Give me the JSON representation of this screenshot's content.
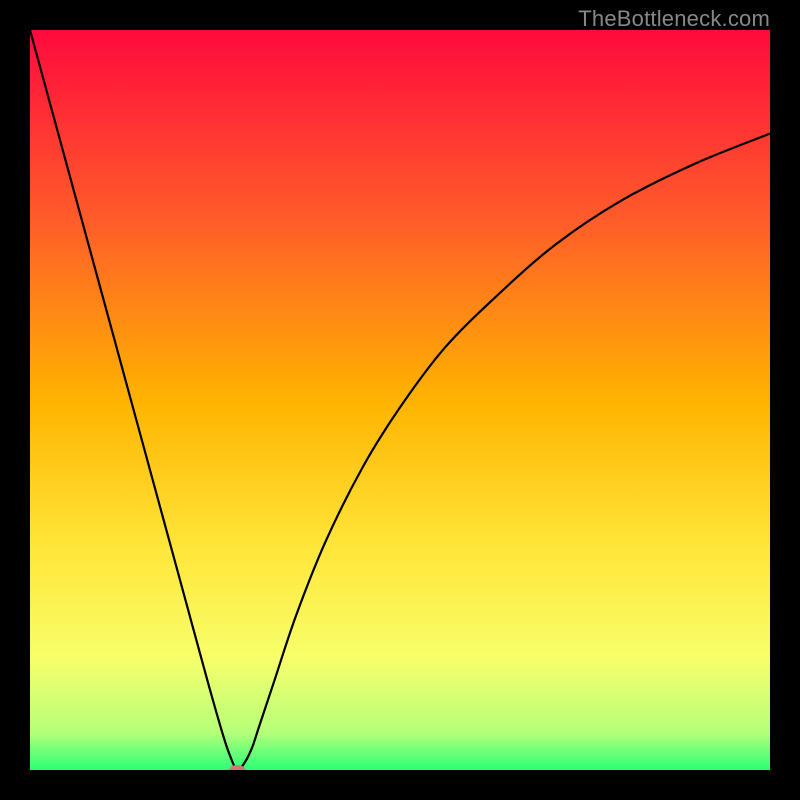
{
  "attribution": "TheBottleneck.com",
  "chart_data": {
    "type": "line",
    "title": "",
    "xlabel": "",
    "ylabel": "",
    "xlim": [
      0,
      100
    ],
    "ylim": [
      0,
      100
    ],
    "grid": false,
    "background_gradient": {
      "stops": [
        {
          "offset": 0,
          "color": "#ff0a3d"
        },
        {
          "offset": 25,
          "color": "#ff5a2a"
        },
        {
          "offset": 50,
          "color": "#ffb300"
        },
        {
          "offset": 70,
          "color": "#ffe63a"
        },
        {
          "offset": 85,
          "color": "#f7ff6b"
        },
        {
          "offset": 95,
          "color": "#b4ff7a"
        },
        {
          "offset": 100,
          "color": "#2bff77"
        }
      ]
    },
    "series": [
      {
        "name": "bottleneck-curve",
        "color": "#000000",
        "x": [
          0,
          3,
          6,
          9,
          12,
          15,
          18,
          21,
          24,
          26,
          27,
          28,
          29,
          30,
          31,
          33,
          36,
          40,
          45,
          50,
          56,
          63,
          71,
          80,
          90,
          100
        ],
        "y": [
          100,
          89,
          78,
          67,
          56,
          45,
          34,
          23,
          12,
          5,
          2,
          0,
          1,
          3,
          6,
          12,
          21,
          31,
          41,
          49,
          57,
          64,
          71,
          77,
          82,
          86
        ]
      }
    ],
    "marker": {
      "name": "valley-marker",
      "x": 28,
      "y": 0,
      "rx": 8,
      "ry": 5,
      "color": "#c97a7a"
    }
  }
}
